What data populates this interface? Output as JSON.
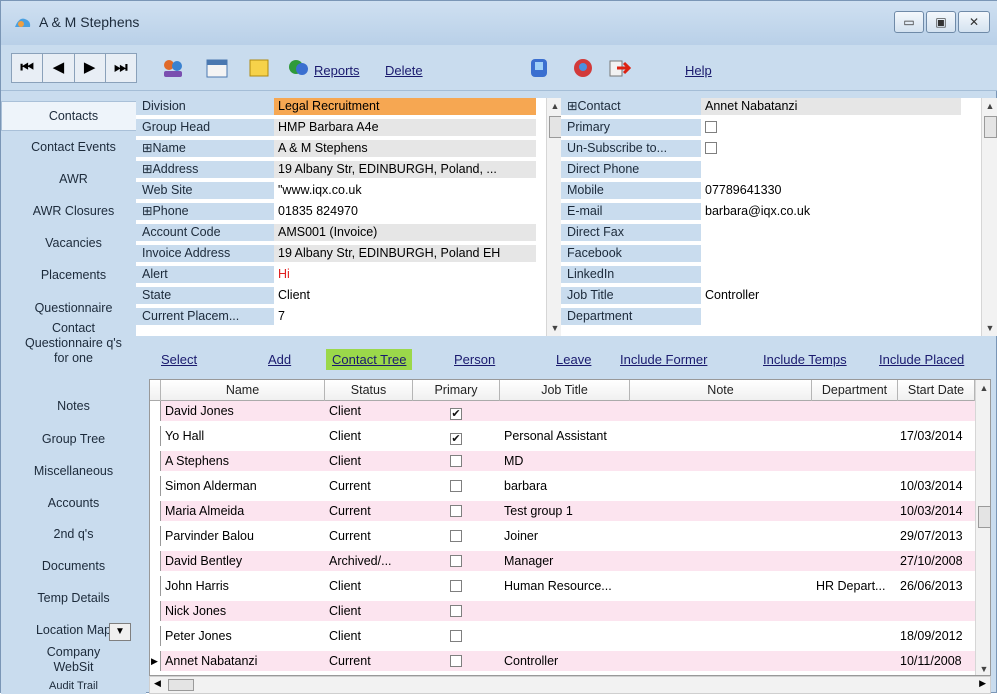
{
  "window": {
    "title": "A & M Stephens",
    "min_glyph": "▭",
    "max_glyph": "▣",
    "close_glyph": "✕"
  },
  "toolbar": {
    "nav": [
      "⏮",
      "◀",
      "▶",
      "⏭"
    ],
    "links": {
      "reports": "Reports",
      "delete": "Delete",
      "help": "Help"
    },
    "icons": [
      "people-icon",
      "calendar-icon",
      "note-icon",
      "merge-icon",
      "phone-icon",
      "contacts-icon",
      "exit-icon"
    ]
  },
  "sidebar": {
    "items": [
      "Contacts",
      "Contact Events",
      "AWR",
      "AWR Closures",
      "Vacancies",
      "Placements",
      "Questionnaire",
      "Contact Questionnaire q's for one",
      "Notes",
      "Group Tree",
      "Miscellaneous",
      "Accounts",
      "2nd q's",
      "Documents",
      "Temp Details",
      "Location Map",
      "Company WebSit",
      "Audit Trail"
    ]
  },
  "left_grid": [
    {
      "label": "Division",
      "value": "Legal Recruitment",
      "style": "hl"
    },
    {
      "label": "Group Head",
      "value": "HMP Barbara A4e",
      "style": "ro"
    },
    {
      "label": "⊞Name",
      "value": "A & M Stephens",
      "style": "ro"
    },
    {
      "label": "⊞Address",
      "value": "19 Albany Str, EDINBURGH, Poland, ...",
      "style": "ro"
    },
    {
      "label": "Web Site",
      "value": "\"www.iqx.co.uk",
      "style": ""
    },
    {
      "label": "⊞Phone",
      "value": "01835 824970",
      "style": ""
    },
    {
      "label": "Account Code",
      "value": "AMS001 (Invoice)",
      "style": "ro"
    },
    {
      "label": "Invoice Address",
      "value": "19 Albany Str, EDINBURGH, Poland EH",
      "style": "ro"
    },
    {
      "label": "Alert",
      "value": "Hi",
      "style": "red"
    },
    {
      "label": "State",
      "value": "Client",
      "style": ""
    },
    {
      "label": "Current Placem...",
      "value": "7",
      "style": ""
    }
  ],
  "right_grid": [
    {
      "label": "⊞Contact",
      "value": "Annet Nabatanzi",
      "style": "ro",
      "check": ""
    },
    {
      "label": "Primary",
      "value": "",
      "style": "",
      "check": "off"
    },
    {
      "label": "Un-Subscribe to...",
      "value": "",
      "style": "",
      "check": "off"
    },
    {
      "label": "Direct Phone",
      "value": "",
      "style": "",
      "check": ""
    },
    {
      "label": "Mobile",
      "value": "07789641330",
      "style": "",
      "check": ""
    },
    {
      "label": "E-mail",
      "value": "barbara@iqx.co.uk",
      "style": "",
      "check": ""
    },
    {
      "label": "Direct Fax",
      "value": "",
      "style": "",
      "check": ""
    },
    {
      "label": "Facebook",
      "value": "",
      "style": "",
      "check": ""
    },
    {
      "label": "LinkedIn",
      "value": "",
      "style": "",
      "check": ""
    },
    {
      "label": "Job Title",
      "value": "Controller",
      "style": "",
      "check": ""
    },
    {
      "label": "Department",
      "value": "",
      "style": "",
      "check": ""
    }
  ],
  "subtoolbar": [
    "Select",
    "Add",
    "Contact Tree",
    "Person",
    "Leave",
    "Include Former",
    "Include Temps",
    "Include Placed"
  ],
  "table": {
    "columns": [
      "Name",
      "Status",
      "Primary",
      "Job Title",
      "Note",
      "Department",
      "Start Date"
    ],
    "rows": [
      {
        "name": "David Jones",
        "status": "Client",
        "primary": true,
        "job": "",
        "note": "",
        "dept": "",
        "start": ""
      },
      {
        "name": "Yo Hall",
        "status": "Client",
        "primary": true,
        "job": "Personal Assistant",
        "note": "",
        "dept": "",
        "start": "17/03/2014"
      },
      {
        "name": "A Stephens",
        "status": "Client",
        "primary": false,
        "job": "MD",
        "note": "",
        "dept": "",
        "start": ""
      },
      {
        "name": "Simon Alderman",
        "status": "Current",
        "primary": false,
        "job": "barbara",
        "note": "",
        "dept": "",
        "start": "10/03/2014"
      },
      {
        "name": "Maria Almeida",
        "status": "Current",
        "primary": false,
        "job": "Test group 1",
        "note": "",
        "dept": "",
        "start": "10/03/2014"
      },
      {
        "name": "Parvinder Balou",
        "status": "Current",
        "primary": false,
        "job": "Joiner",
        "note": "",
        "dept": "",
        "start": "29/07/2013"
      },
      {
        "name": "David Bentley",
        "status": "Archived/...",
        "primary": false,
        "job": "Manager",
        "note": "",
        "dept": "",
        "start": "27/10/2008"
      },
      {
        "name": "John Harris",
        "status": "Client",
        "primary": false,
        "job": "Human Resource...",
        "note": "",
        "dept": "HR Depart...",
        "start": "26/06/2013"
      },
      {
        "name": "Nick Jones",
        "status": "Client",
        "primary": false,
        "job": "",
        "note": "",
        "dept": "",
        "start": ""
      },
      {
        "name": "Peter Jones",
        "status": "Client",
        "primary": false,
        "job": "",
        "note": "",
        "dept": "",
        "start": "18/09/2012"
      },
      {
        "name": "Annet Nabatanzi",
        "status": "Current",
        "primary": false,
        "job": "Controller",
        "note": "",
        "dept": "",
        "start": "10/11/2008"
      }
    ]
  }
}
